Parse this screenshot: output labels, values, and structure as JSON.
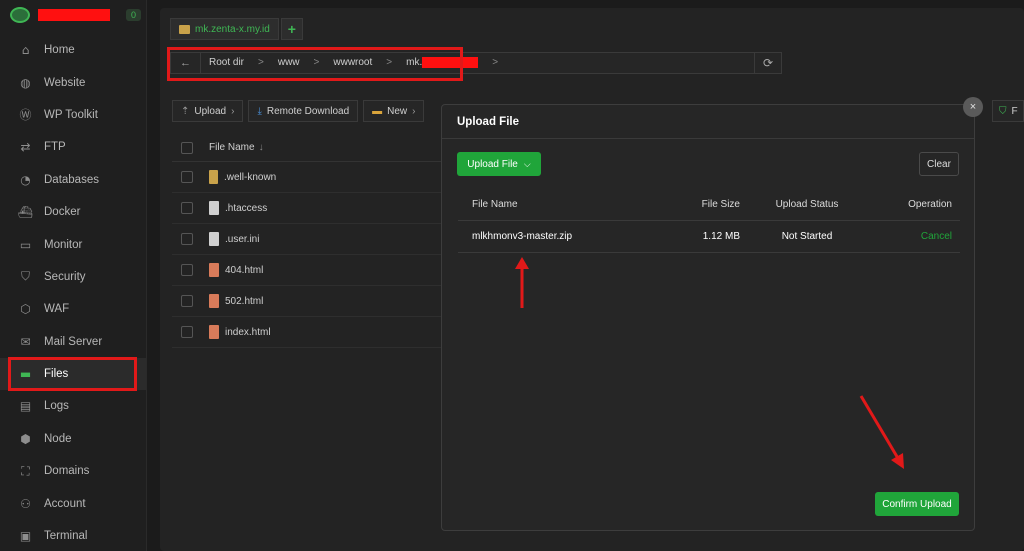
{
  "sidebar": {
    "badge": "0",
    "items": [
      {
        "label": "Home",
        "icon": "home-icon",
        "glyph": "⌂"
      },
      {
        "label": "Website",
        "icon": "globe-icon",
        "glyph": "◍"
      },
      {
        "label": "WP Toolkit",
        "icon": "wordpress-icon",
        "glyph": "Ⓦ"
      },
      {
        "label": "FTP",
        "icon": "transfer-icon",
        "glyph": "⇄"
      },
      {
        "label": "Databases",
        "icon": "database-icon",
        "glyph": "◔"
      },
      {
        "label": "Docker",
        "icon": "docker-icon",
        "glyph": "⛴"
      },
      {
        "label": "Monitor",
        "icon": "monitor-icon",
        "glyph": "▭"
      },
      {
        "label": "Security",
        "icon": "shield-icon",
        "glyph": "⛉"
      },
      {
        "label": "WAF",
        "icon": "waf-icon",
        "glyph": "⬡"
      },
      {
        "label": "Mail Server",
        "icon": "mail-icon",
        "glyph": "✉"
      },
      {
        "label": "Files",
        "icon": "folder-icon",
        "glyph": "▬"
      },
      {
        "label": "Logs",
        "icon": "logs-icon",
        "glyph": "▤"
      },
      {
        "label": "Node",
        "icon": "node-icon",
        "glyph": "⬢"
      },
      {
        "label": "Domains",
        "icon": "domains-icon",
        "glyph": "⛶"
      },
      {
        "label": "Account",
        "icon": "user-icon",
        "glyph": "⚇"
      },
      {
        "label": "Terminal",
        "icon": "terminal-icon",
        "glyph": "▣"
      }
    ],
    "active_index": 10
  },
  "tabs": {
    "current": "mk.zenta-x.my.id",
    "add_label": "+"
  },
  "breadcrumb": {
    "back": "←",
    "items": [
      "Root dir",
      "www",
      "wwwroot",
      "mk."
    ],
    "sep": ">",
    "refresh": "⟳"
  },
  "toolbar": {
    "upload": "Upload",
    "remote_download": "Remote Download",
    "new": "New",
    "right_label": "F"
  },
  "files": {
    "header": "File Name",
    "sort_icon": "↓",
    "rows": [
      {
        "name": ".well-known",
        "type": "folder"
      },
      {
        "name": ".htaccess",
        "type": "file"
      },
      {
        "name": ".user.ini",
        "type": "file"
      },
      {
        "name": "404.html",
        "type": "html"
      },
      {
        "name": "502.html",
        "type": "html"
      },
      {
        "name": "index.html",
        "type": "html"
      }
    ]
  },
  "modal": {
    "title": "Upload File",
    "close": "×",
    "upload_button": "Upload File",
    "clear_button": "Clear",
    "columns": [
      "File Name",
      "File Size",
      "Upload Status",
      "Operation"
    ],
    "rows": [
      {
        "name": "mlkhmonv3-master.zip",
        "size": "1.12 MB",
        "status": "Not Started",
        "operation": "Cancel"
      }
    ],
    "confirm_button": "Confirm Upload"
  },
  "colors": {
    "accent": "#20a53a",
    "annotation": "#e11919"
  }
}
